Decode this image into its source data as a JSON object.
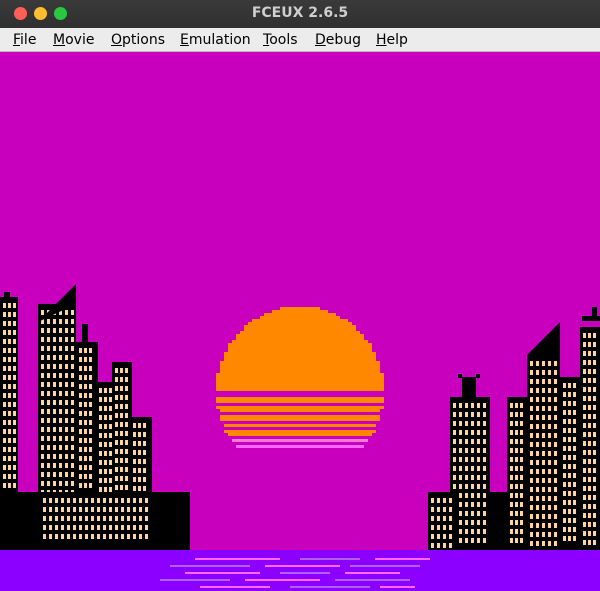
{
  "window": {
    "title": "FCEUX 2.6.5"
  },
  "menu": [
    {
      "label": "File"
    },
    {
      "label": "Movie"
    },
    {
      "label": "Options"
    },
    {
      "label": "Emulation"
    },
    {
      "label": "Tools"
    },
    {
      "label": "Debug"
    },
    {
      "label": "Help"
    }
  ],
  "scene": {
    "sky_color": "#c800be",
    "sun_color": "#ff8800",
    "water_color": "#8b00ff",
    "building_color": "#000000",
    "window_color": "#ffd4a0",
    "reflection_colors": [
      "#ff66ff",
      "#b060ff"
    ]
  }
}
